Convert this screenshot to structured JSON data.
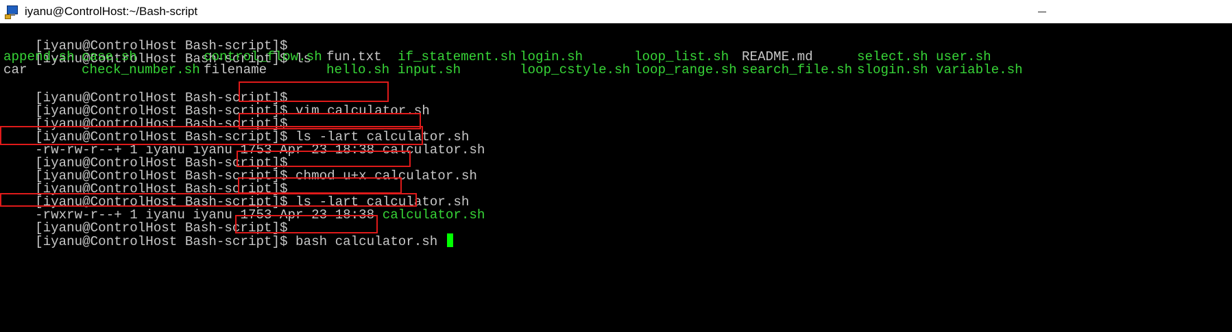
{
  "window": {
    "title": "iyanu@ControlHost:~/Bash-script"
  },
  "prompt": "[iyanu@ControlHost Bash-script]$",
  "commands": {
    "ls": "ls",
    "vim": "vim calculator.sh",
    "ls_lart_1": "ls -lart calculator.sh",
    "chmod": "chmod u+x calculator.sh",
    "ls_lart_2": "ls -lart calculator.sh",
    "bash": "bash calculator.sh"
  },
  "ls_output": {
    "row1": [
      "append.sh",
      "case.sh",
      "control_flow.sh",
      "fun.txt",
      "if_statement.sh",
      "login.sh",
      "loop_list.sh",
      "README.md",
      "select.sh",
      "user.sh"
    ],
    "row2": [
      "car",
      "check_number.sh",
      "filename",
      "hello.sh",
      "input.sh",
      "loop_cstyle.sh",
      "loop_range.sh",
      "search_file.sh",
      "slogin.sh",
      "variable.sh"
    ]
  },
  "file_listing_1": {
    "meta": "-rw-rw-r--+ 1 iyanu iyanu 1753 Apr 23 18:38 ",
    "name": "calculator.sh"
  },
  "file_listing_2": {
    "meta": "-rwxrw-r--+ 1 iyanu iyanu 1753 Apr 23 18:38 ",
    "name": "calculator.sh"
  },
  "colors": {
    "terminal_bg": "#000000",
    "terminal_fg": "#c7c7c7",
    "executable_green": "#37d437",
    "cursor_green": "#00ff00",
    "highlight_red": "#e01a1a"
  }
}
